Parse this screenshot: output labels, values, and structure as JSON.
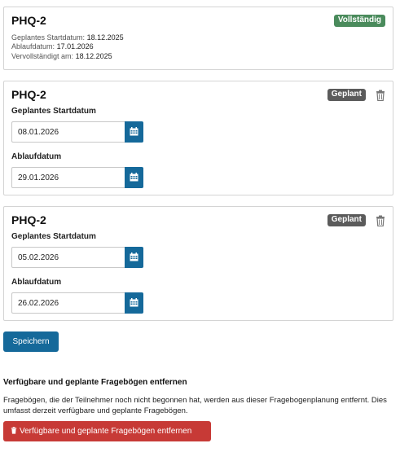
{
  "cards": [
    {
      "title": "PHQ-2",
      "status": "Vollständig",
      "planned_start_label": "Geplantes Startdatum:",
      "planned_start_value": "18.12.2025",
      "expiry_label": "Ablaufdatum:",
      "expiry_value": "17.01.2026",
      "completed_label": "Vervollständigt am:",
      "completed_value": "18.12.2025"
    },
    {
      "title": "PHQ-2",
      "status": "Geplant",
      "start_label": "Geplantes Startdatum",
      "start_value": "08.01.2026",
      "expiry_label": "Ablaufdatum",
      "expiry_value": "29.01.2026"
    },
    {
      "title": "PHQ-2",
      "status": "Geplant",
      "start_label": "Geplantes Startdatum",
      "start_value": "05.02.2026",
      "expiry_label": "Ablaufdatum",
      "expiry_value": "26.02.2026"
    }
  ],
  "save_button": "Speichern",
  "remove_section": {
    "heading": "Verfügbare und geplante Fragebögen entfernen",
    "text": "Fragebögen, die der Teilnehmer noch nicht begonnen hat, werden aus dieser Fragebogenplanung entfernt. Dies umfasst derzeit verfügbare und geplante Fragebögen.",
    "button": "Verfügbare und geplante Fragebögen entfernen"
  },
  "colors": {
    "primary": "#15699a",
    "success_badge": "#4a8b5c",
    "planned_badge": "#5b5b5b",
    "danger": "#c73a36"
  },
  "icons": [
    "calendar-icon",
    "trash-icon"
  ]
}
